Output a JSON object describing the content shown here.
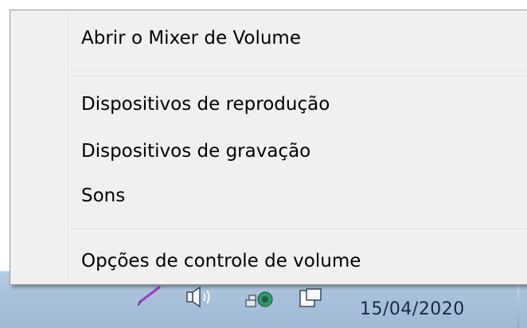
{
  "menu": {
    "items": [
      {
        "label": "Abrir o Mixer de Volume"
      },
      {
        "label": "Dispositivos de reprodução"
      },
      {
        "label": "Dispositivos de gravação"
      },
      {
        "label": "Sons"
      },
      {
        "label": "Opções de controle de volume"
      }
    ]
  },
  "taskbar": {
    "date": "15/04/2020",
    "icons": [
      "pen-icon",
      "speaker-icon",
      "network-icon",
      "action-center-flag-icon"
    ]
  },
  "colors": {
    "menu_background": "#f0f0f0",
    "menu_border": "#979797",
    "taskbar": "#a9c1db"
  }
}
